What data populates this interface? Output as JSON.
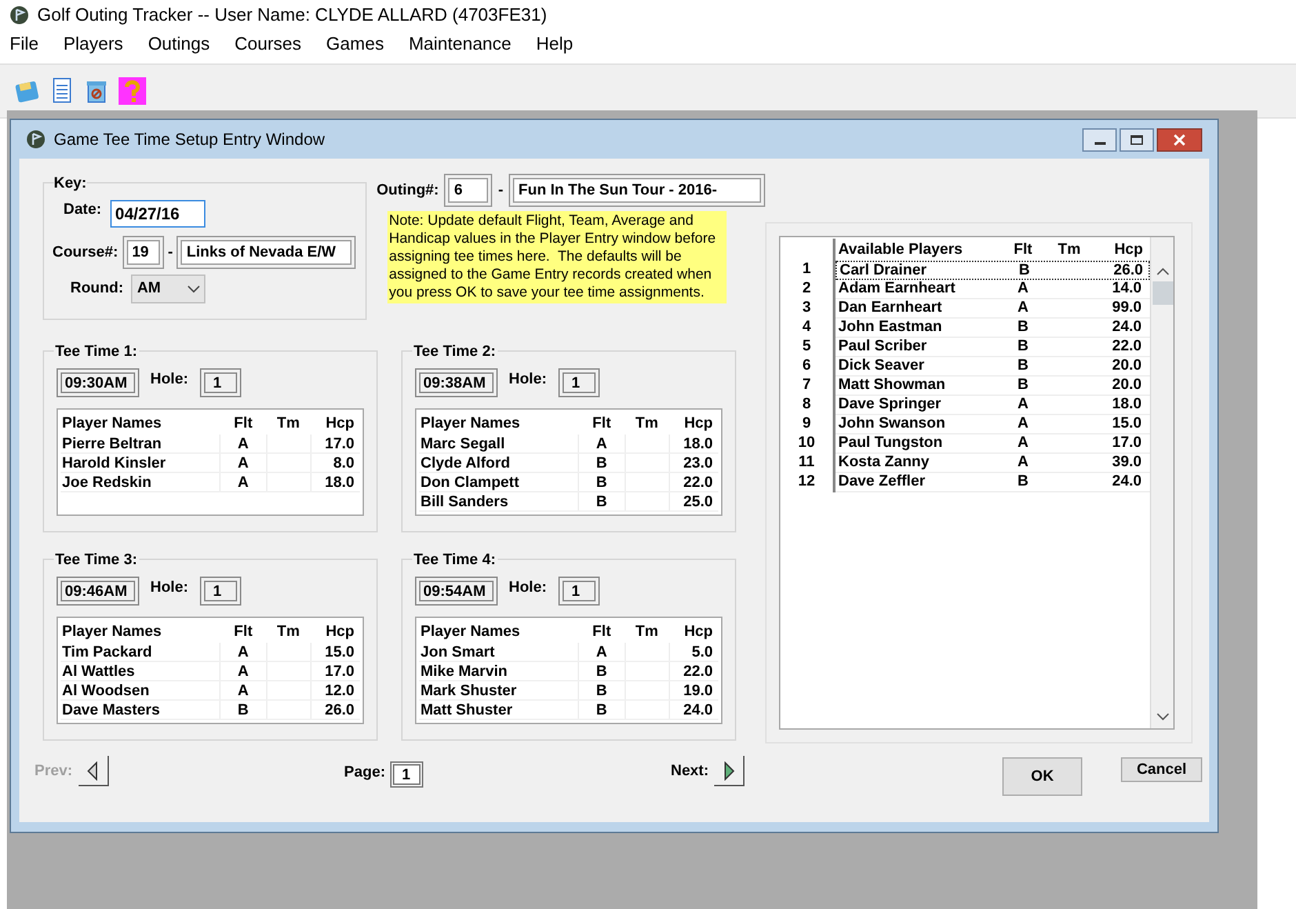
{
  "app": {
    "title": "Golf Outing Tracker -- User Name: CLYDE ALLARD (4703FE31)",
    "menu": [
      "File",
      "Players",
      "Outings",
      "Courses",
      "Games",
      "Maintenance",
      "Help"
    ]
  },
  "window": {
    "title": "Game Tee Time Setup Entry Window"
  },
  "key": {
    "label": "Key:",
    "date_label": "Date:",
    "date": "04/27/16",
    "course_label": "Course#:",
    "course_number": "19",
    "course_separator": "-",
    "course_name": "Links of Nevada E/W",
    "round_label": "Round:",
    "round": "AM"
  },
  "outing": {
    "label": "Outing#:",
    "number": "6",
    "separator": "-",
    "name": "Fun In The Sun Tour - 2016-"
  },
  "note": "Note: Update default Flight, Team, Average and Handicap values in the Player Entry window before assigning tee times here.  The defaults will be assigned to the Game Entry records created when you press OK to save your tee time assignments.",
  "tee_times": [
    {
      "title": "Tee Time 1:",
      "time": "09:30AM",
      "hole_label": "Hole:",
      "hole": "1",
      "columns": [
        "Player Names",
        "Flt",
        "Tm",
        "Hcp"
      ],
      "rows": [
        {
          "name": "Pierre Beltran",
          "flt": "A",
          "hcp": "17.0"
        },
        {
          "name": "Harold Kinsler",
          "flt": "A",
          "hcp": "8.0"
        },
        {
          "name": "Joe Redskin",
          "flt": "A",
          "hcp": "18.0"
        }
      ]
    },
    {
      "title": "Tee Time 2:",
      "time": "09:38AM",
      "hole_label": "Hole:",
      "hole": "1",
      "columns": [
        "Player Names",
        "Flt",
        "Tm",
        "Hcp"
      ],
      "rows": [
        {
          "name": "Marc Segall",
          "flt": "A",
          "hcp": "18.0"
        },
        {
          "name": "Clyde Alford",
          "flt": "B",
          "hcp": "23.0"
        },
        {
          "name": "Don Clampett",
          "flt": "B",
          "hcp": "22.0"
        },
        {
          "name": "Bill Sanders",
          "flt": "B",
          "hcp": "25.0"
        }
      ]
    },
    {
      "title": "Tee Time 3:",
      "time": "09:46AM",
      "hole_label": "Hole:",
      "hole": "1",
      "columns": [
        "Player Names",
        "Flt",
        "Tm",
        "Hcp"
      ],
      "rows": [
        {
          "name": "Tim Packard",
          "flt": "A",
          "hcp": "15.0"
        },
        {
          "name": "Al Wattles",
          "flt": "A",
          "hcp": "17.0"
        },
        {
          "name": "Al Woodsen",
          "flt": "A",
          "hcp": "12.0"
        },
        {
          "name": "Dave Masters",
          "flt": "B",
          "hcp": "26.0"
        }
      ]
    },
    {
      "title": "Tee Time 4:",
      "time": "09:54AM",
      "hole_label": "Hole:",
      "hole": "1",
      "columns": [
        "Player Names",
        "Flt",
        "Tm",
        "Hcp"
      ],
      "rows": [
        {
          "name": "Jon Smart",
          "flt": "A",
          "hcp": "5.0"
        },
        {
          "name": "Mike Marvin",
          "flt": "B",
          "hcp": "22.0"
        },
        {
          "name": "Mark Shuster",
          "flt": "B",
          "hcp": "19.0"
        },
        {
          "name": "Matt Shuster",
          "flt": "B",
          "hcp": "24.0"
        }
      ]
    }
  ],
  "available": {
    "columns": [
      "Available Players",
      "Flt",
      "Tm",
      "Hcp"
    ],
    "rows": [
      {
        "number": "1",
        "name": "Carl Drainer",
        "flt": "B",
        "hcp": "26.0",
        "selected": true
      },
      {
        "number": "2",
        "name": "Adam Earnheart",
        "flt": "A",
        "hcp": "14.0",
        "selected": false
      },
      {
        "number": "3",
        "name": "Dan Earnheart",
        "flt": "A",
        "hcp": "99.0",
        "selected": false
      },
      {
        "number": "4",
        "name": "John Eastman",
        "flt": "B",
        "hcp": "24.0",
        "selected": false
      },
      {
        "number": "5",
        "name": "Paul Scriber",
        "flt": "B",
        "hcp": "22.0",
        "selected": false
      },
      {
        "number": "6",
        "name": "Dick Seaver",
        "flt": "B",
        "hcp": "20.0",
        "selected": false
      },
      {
        "number": "7",
        "name": "Matt Showman",
        "flt": "B",
        "hcp": "20.0",
        "selected": false
      },
      {
        "number": "8",
        "name": "Dave Springer",
        "flt": "A",
        "hcp": "18.0",
        "selected": false
      },
      {
        "number": "9",
        "name": "John Swanson",
        "flt": "A",
        "hcp": "15.0",
        "selected": false
      },
      {
        "number": "10",
        "name": "Paul Tungston",
        "flt": "A",
        "hcp": "17.0",
        "selected": false
      },
      {
        "number": "11",
        "name": "Kosta Zanny",
        "flt": "A",
        "hcp": "39.0",
        "selected": false
      },
      {
        "number": "12",
        "name": "Dave Zeffler",
        "flt": "B",
        "hcp": "24.0",
        "selected": false
      }
    ]
  },
  "footer": {
    "prev": {
      "label": "Prev:",
      "disabled": true
    },
    "page_label": "Page:",
    "page": "1",
    "next": {
      "label": "Next:",
      "disabled": false
    },
    "ok": "OK",
    "cancel": "Cancel"
  }
}
